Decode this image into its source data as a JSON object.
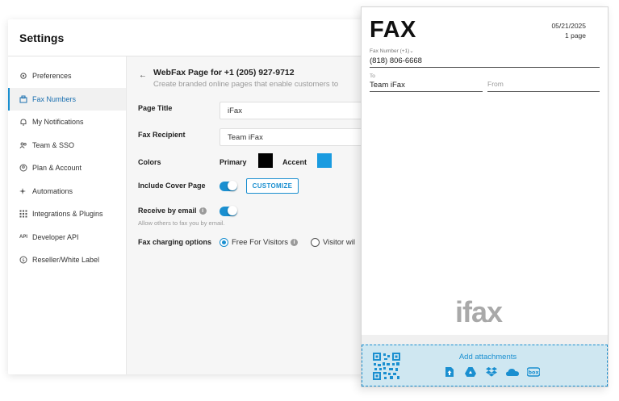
{
  "settings": {
    "title": "Settings",
    "sidebar": [
      {
        "label": "Preferences",
        "icon": "gear-icon",
        "active": false
      },
      {
        "label": "Fax Numbers",
        "icon": "fax-icon",
        "active": true
      },
      {
        "label": "My Notifications",
        "icon": "bell-icon",
        "active": false
      },
      {
        "label": "Team & SSO",
        "icon": "users-icon",
        "active": false
      },
      {
        "label": "Plan & Account",
        "icon": "account-icon",
        "active": false
      },
      {
        "label": "Automations",
        "icon": "sparkle-icon",
        "active": false
      },
      {
        "label": "Integrations & Plugins",
        "icon": "grid-icon",
        "active": false
      },
      {
        "label": "Developer API",
        "icon": "api-icon",
        "active": false
      },
      {
        "label": "Reseller/White Label",
        "icon": "tag-icon",
        "active": false
      }
    ],
    "main": {
      "heading": "WebFax Page for +1 (205) 927-9712",
      "subheading": "Create branded online pages that enable customers to",
      "page_title_label": "Page Title",
      "page_title_value": "iFax",
      "fax_recipient_label": "Fax Recipient",
      "fax_recipient_value": "Team iFax",
      "colors_label": "Colors",
      "primary_label": "Primary",
      "primary_color": "#000000",
      "accent_label": "Accent",
      "accent_color": "#1a9be0",
      "cover_page_label": "Include Cover Page",
      "cover_page_on": true,
      "customize_label": "CUSTOMIZE",
      "receive_email_label": "Receive by email",
      "receive_email_on": true,
      "receive_email_hint": "Allow others to fax you by email.",
      "charging_label": "Fax charging options",
      "charging_options": [
        "Free For Visitors",
        "Visitor wil"
      ],
      "charging_selected": "Free For Visitors"
    }
  },
  "fax_preview": {
    "title": "FAX",
    "date": "05/21/2025",
    "pages": "1 page",
    "fax_number_label": "Fax Number (+1)⌄",
    "fax_number_value": "(818) 806-6668",
    "to_label": "To",
    "to_value": "Team iFax",
    "from_placeholder": "From",
    "logo_text": "ifax",
    "add_attachments_label": "Add attachments",
    "attachment_icons": [
      "file-upload-icon",
      "google-drive-icon",
      "dropbox-icon",
      "onedrive-icon",
      "box-icon"
    ]
  },
  "colors": {
    "accent_blue": "#1a8fd0",
    "attach_bg": "#cfe7f1"
  }
}
